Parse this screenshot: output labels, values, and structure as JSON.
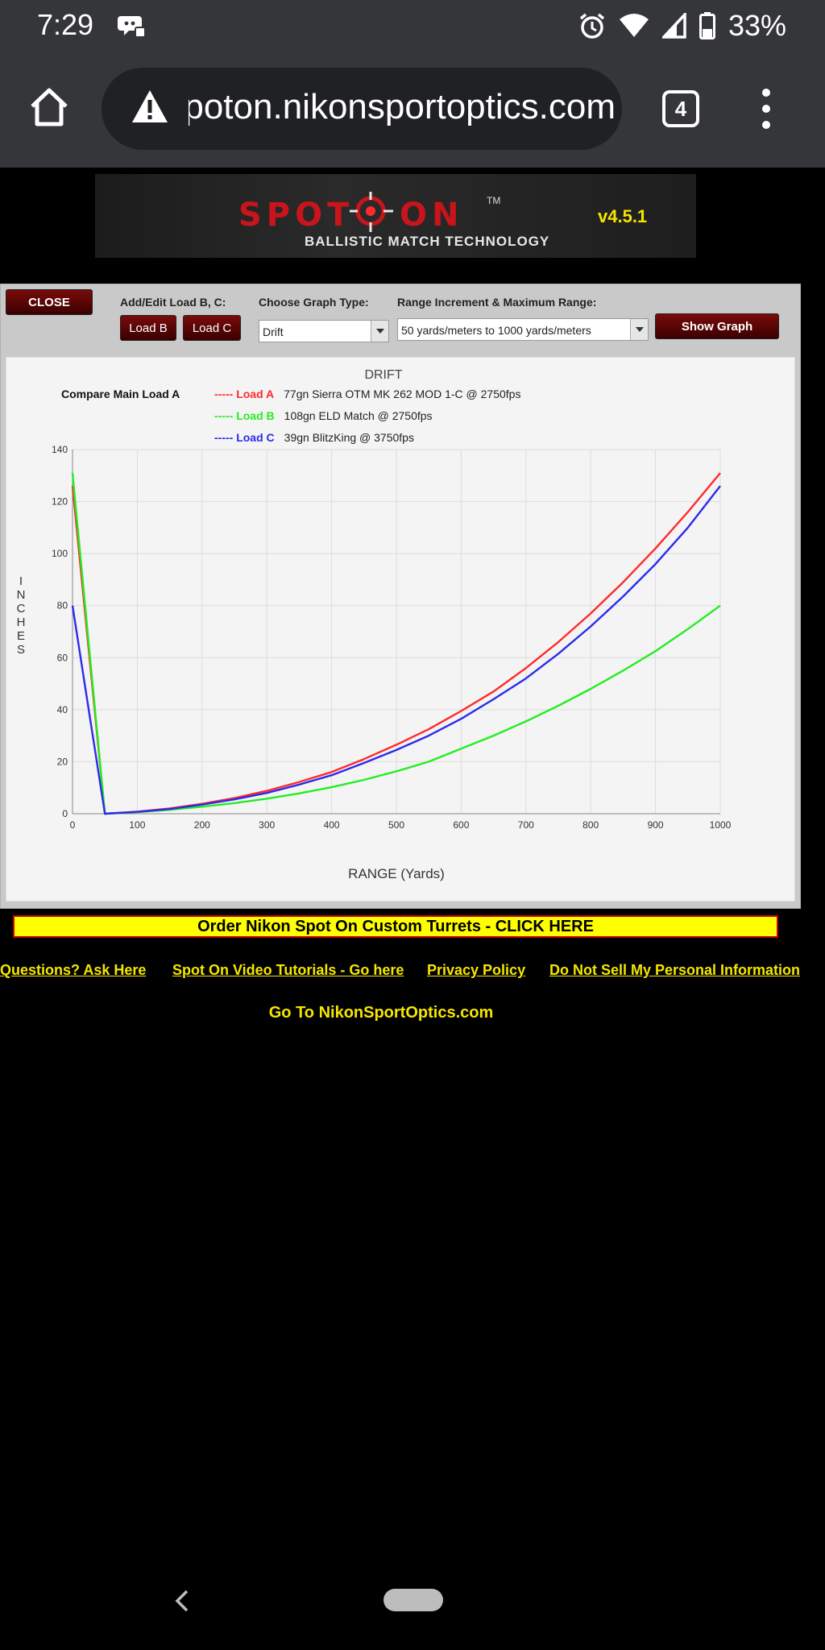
{
  "status": {
    "time": "7:29",
    "battery": "33%"
  },
  "browser": {
    "url": "spoton.nikonsportoptics.com",
    "tab_count": "4"
  },
  "banner": {
    "logo_spot": "SPOT",
    "logo_on": "ON",
    "logo_tm": "TM",
    "logo_subtitle": "BALLISTIC MATCH TECHNOLOGY",
    "version": "v4.5.1"
  },
  "controls": {
    "close_label": "CLOSE",
    "add_edit_label": "Add/Edit Load B, C:",
    "load_b_label": "Load B",
    "load_c_label": "Load C",
    "graph_type_label": "Choose Graph Type:",
    "graph_type_value": "Drift",
    "range_label": "Range Increment & Maximum Range:",
    "range_value": "50 yards/meters to 1000 yards/meters",
    "show_graph_label": "Show Graph"
  },
  "chart_data": {
    "type": "line",
    "title": "DRIFT",
    "compare_label": "Compare Main Load A",
    "legend_prefix": "-----",
    "xlabel": "RANGE  (Yards)",
    "ylabel": "INCHES",
    "xlim": [
      0,
      1000
    ],
    "ylim": [
      0,
      140
    ],
    "xticks": [
      "0",
      "100",
      "200",
      "300",
      "400",
      "500",
      "600",
      "700",
      "800",
      "900",
      "1000"
    ],
    "yticks": [
      "0",
      "20",
      "40",
      "60",
      "80",
      "100",
      "120",
      "140"
    ],
    "grid": true,
    "x": [
      0,
      50,
      100,
      150,
      200,
      250,
      300,
      350,
      400,
      450,
      500,
      550,
      600,
      650,
      700,
      750,
      800,
      850,
      900,
      950,
      1000
    ],
    "series": [
      {
        "name": "Load A",
        "description": "77gn Sierra OTM MK 262 MOD 1-C @ 2750fps",
        "color": "#ff2a2a",
        "values": [
          126,
          0,
          0.8,
          2,
          3.8,
          6,
          8.8,
          12.2,
          16,
          21,
          26.5,
          32.5,
          39.5,
          47,
          56,
          66,
          77,
          89,
          102,
          116,
          131
        ]
      },
      {
        "name": "Load B",
        "description": "108gn ELD Match @ 2750fps",
        "color": "#22ee22",
        "values": [
          131,
          0,
          0.6,
          1.5,
          2.7,
          4.1,
          5.8,
          7.8,
          10.2,
          13,
          16.3,
          20,
          25,
          30,
          35.5,
          41.5,
          48,
          55,
          62.5,
          71,
          80
        ]
      },
      {
        "name": "Load C",
        "description": "39gn BlitzKing @ 3750fps",
        "color": "#2a2aee",
        "values": [
          80,
          0,
          0.7,
          1.8,
          3.5,
          5.5,
          8,
          11.2,
          14.8,
          19.5,
          24.5,
          30,
          36.5,
          44,
          52,
          61.5,
          72,
          83.5,
          96,
          110,
          126
        ]
      }
    ]
  },
  "footer": {
    "order": "Order Nikon Spot On Custom Turrets - CLICK HERE",
    "questions": "Questions? Ask Here",
    "tutorials": "Spot On Video Tutorials - Go here",
    "privacy": "Privacy Policy",
    "do_not_sell": "Do Not Sell My Personal Information",
    "home": "Go To NikonSportOptics.com"
  },
  "colors": {
    "accent_yellow": "#f5e600",
    "button_dark_red": "#5a0000",
    "logo_red": "#c8151b"
  }
}
